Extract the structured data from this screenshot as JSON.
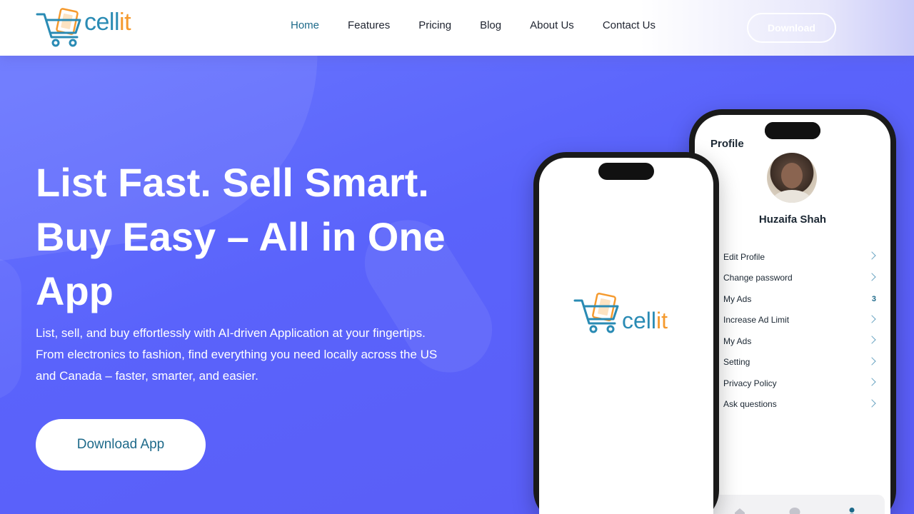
{
  "brand": {
    "name_main": "cell",
    "name_accent": "it"
  },
  "nav": {
    "items": [
      "Home",
      "Features",
      "Pricing",
      "Blog",
      "About Us",
      "Contact Us"
    ],
    "active": "Home",
    "download_label": "Download"
  },
  "hero": {
    "headline_1": "List Fast. Sell Smart.",
    "headline_2": "Buy Easy – All in One",
    "headline_3": "App",
    "subtext": "List, sell, and buy effortlessly with AI-driven Application at your fingertips. From electronics to fashion, find everything you need locally across the US and Canada – faster, smarter, and easier.",
    "cta_label": "Download App"
  },
  "profile_screen": {
    "title": "Profile",
    "username": "Huzaifa Shah",
    "menu": [
      {
        "label": "Edit Profile",
        "count": ""
      },
      {
        "label": "Change password",
        "count": ""
      },
      {
        "label": "My Ads",
        "count": "3"
      },
      {
        "label": "Increase Ad Limit",
        "count": ""
      },
      {
        "label": "My Ads",
        "count": ""
      },
      {
        "label": "Setting",
        "count": ""
      },
      {
        "label": "Privacy Policy",
        "count": ""
      },
      {
        "label": "Ask questions",
        "count": ""
      }
    ],
    "tabs": [
      "home-icon",
      "chat-icon",
      "profile-icon"
    ]
  },
  "colors": {
    "primary": "#5a63fb",
    "brand_blue": "#2a8bb4",
    "brand_orange": "#f59a2e",
    "nav_active": "#1e6a8a"
  }
}
